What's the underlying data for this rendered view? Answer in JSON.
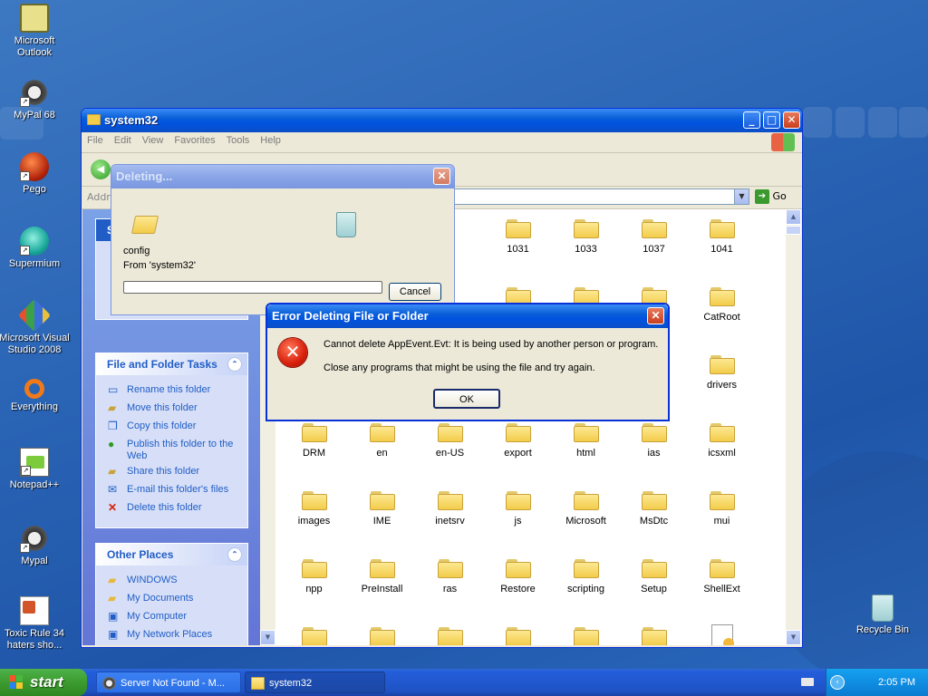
{
  "desktop": {
    "icons": [
      {
        "label": "Microsoft Outlook",
        "icon": "outlook-icon"
      },
      {
        "label": "MyPal 68",
        "icon": "mypal-raccoon-icon"
      },
      {
        "label": "Pego",
        "icon": "pego-icon"
      },
      {
        "label": "Supermium",
        "icon": "supermium-icon"
      },
      {
        "label": "Microsoft Visual Studio 2008",
        "icon": "visual-studio-icon"
      },
      {
        "label": "Everything",
        "icon": "everything-search-icon"
      },
      {
        "label": "Notepad++",
        "icon": "notepad-plus-plus-icon"
      },
      {
        "label": "Mypal",
        "icon": "mypal-raccoon-icon"
      },
      {
        "label": "Toxic Rule 34 haters sho...",
        "icon": "powerpoint-file-icon"
      }
    ],
    "recycle_bin": "Recycle Bin"
  },
  "explorer": {
    "title": "system32",
    "menu": [
      "File",
      "Edit",
      "View",
      "Favorites",
      "Tools",
      "Help"
    ],
    "address_label": "Addre",
    "go_label": "Go",
    "left_pane": {
      "search_partial": "Search for files or folders",
      "file_tasks": {
        "title": "File and Folder Tasks",
        "items": [
          "Rename this folder",
          "Move this folder",
          "Copy this folder",
          "Publish this folder to the Web",
          "Share this folder",
          "E-mail this folder's files",
          "Delete this folder"
        ]
      },
      "other_places": {
        "title": "Other Places",
        "items": [
          "WINDOWS",
          "My Documents",
          "My Computer",
          "My Network Places"
        ]
      }
    },
    "folders": {
      "row1": [
        "1031",
        "1033",
        "1037",
        "1041"
      ],
      "row2_last": "CatRoot",
      "row3_last": "drivers",
      "row4": [
        "DRM",
        "en",
        "en-US",
        "export",
        "html",
        "ias",
        "icsxml"
      ],
      "row5": [
        "images",
        "IME",
        "inetsrv",
        "js",
        "Microsoft",
        "MsDtc",
        "mui"
      ],
      "row6": [
        "npp",
        "PreInstall",
        "ras",
        "Restore",
        "scripting",
        "Setup",
        "ShellExt"
      ]
    }
  },
  "deleting_dialog": {
    "title": "Deleting...",
    "item": "config",
    "from": "From 'system32'",
    "cancel": "Cancel",
    "progress": 0
  },
  "error_dialog": {
    "title": "Error Deleting File or Folder",
    "message": "Cannot delete AppEvent.Evt: It is being used by another person or program.",
    "hint": "Close any programs that might be using the file and try again.",
    "ok": "OK"
  },
  "taskbar": {
    "start": "start",
    "tasks": [
      {
        "label": "Server Not Found - M...",
        "active": false
      },
      {
        "label": "system32",
        "active": true
      }
    ],
    "clock": "2:05 PM"
  }
}
